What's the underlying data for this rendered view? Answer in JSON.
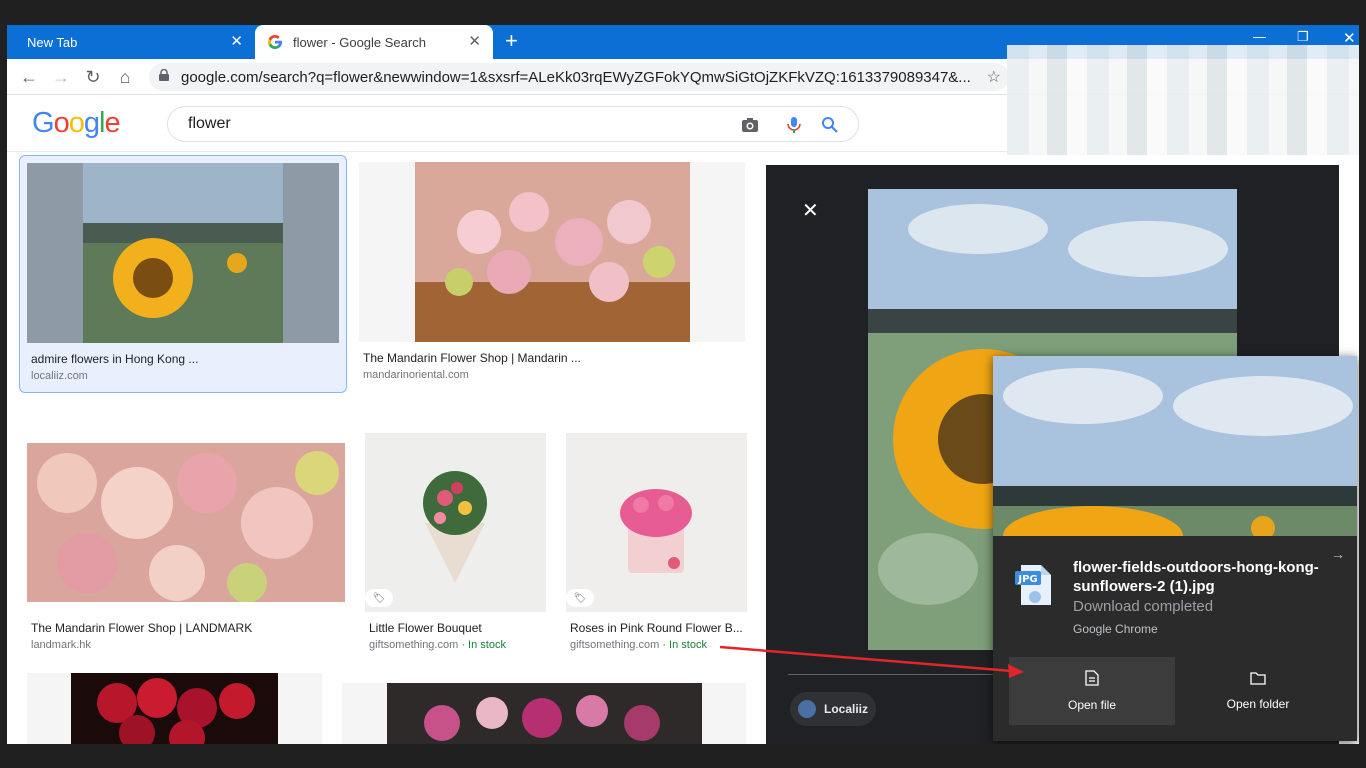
{
  "tabs": [
    {
      "label": "New Tab"
    },
    {
      "label": "flower - Google Search"
    }
  ],
  "address_bar": {
    "url": "google.com/search?q=flower&newwindow=1&sxsrf=ALeKk03rqEWyZGFokYQmwSiGtOjZKFkVZQ:1613379089347&..."
  },
  "google": {
    "logo_letters": [
      "G",
      "o",
      "o",
      "g",
      "l",
      "e"
    ],
    "query": "flower"
  },
  "results": [
    {
      "caption": "admire flowers in Hong Kong ...",
      "source": "localiiz.com"
    },
    {
      "caption": "The Mandarin Flower Shop | Mandarin ...",
      "source": "mandarinoriental.com"
    },
    {
      "caption": "The Mandarin Flower Shop | LANDMARK",
      "source": "landmark.hk"
    },
    {
      "caption": "Little Flower Bouquet",
      "source": "giftsomething.com",
      "stock": " · In stock"
    },
    {
      "caption": "Roses in Pink Round Flower B...",
      "source": "giftsomething.com",
      "stock": " · In stock"
    }
  ],
  "preview": {
    "source_chip": "Localiiz"
  },
  "download": {
    "filename": "flower-fields-outdoors-hong-kong-sunflowers-2 (1).jpg",
    "status": "Download completed",
    "app": "Google Chrome",
    "file_badge": "JPG",
    "open_file": "Open file",
    "open_folder": "Open folder"
  }
}
